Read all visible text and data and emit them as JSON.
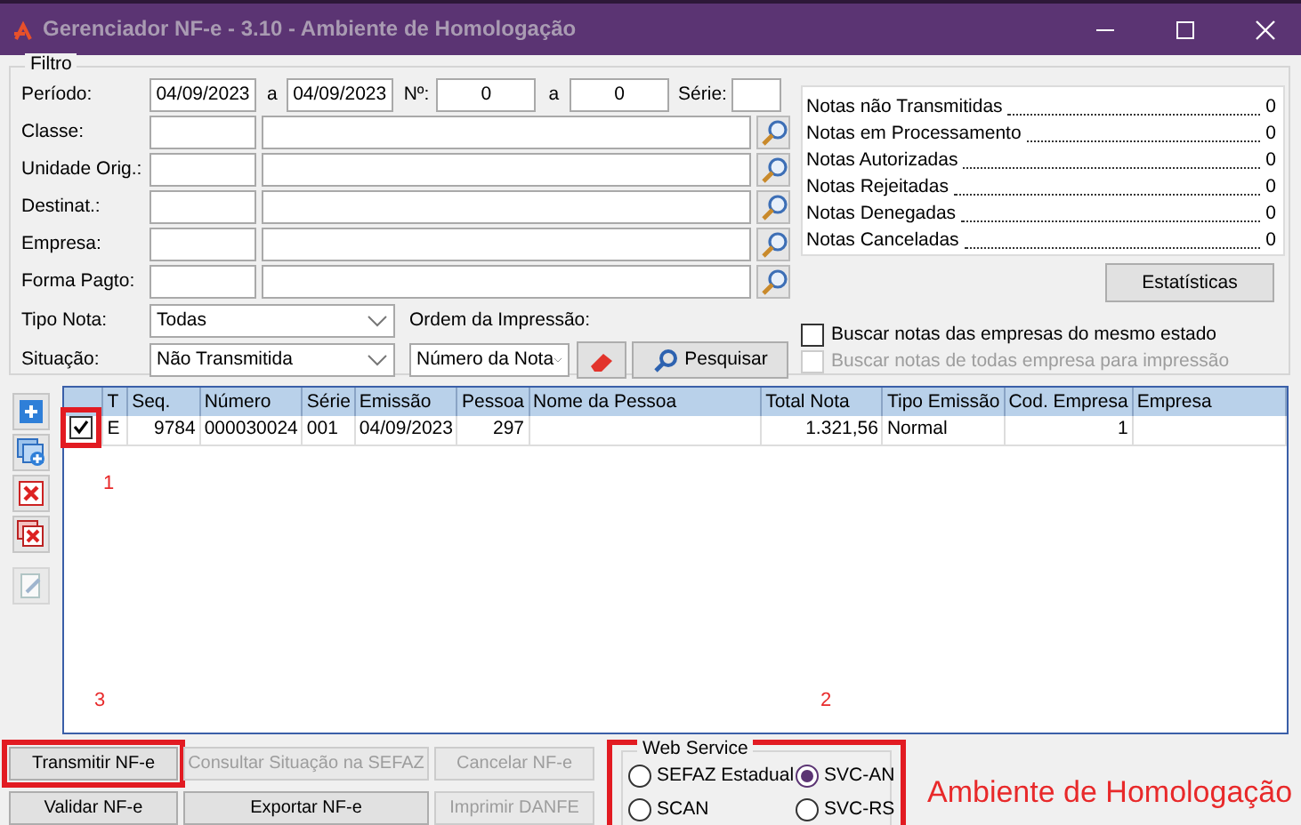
{
  "window": {
    "title": "Gerenciador NF-e - 3.10 - Ambiente de Homologação"
  },
  "filter": {
    "legend": "Filtro",
    "periodo": {
      "label": "Período:",
      "from": "04/09/2023",
      "sep": "a",
      "to": "04/09/2023"
    },
    "numero": {
      "label": "Nº:",
      "from": "0",
      "sep": "a",
      "to": "0"
    },
    "serie": {
      "label": "Série:"
    },
    "lookups": [
      {
        "label": "Classe:"
      },
      {
        "label": "Unidade Orig.:"
      },
      {
        "label": "Destinat.:"
      },
      {
        "label": "Empresa:"
      },
      {
        "label": "Forma Pagto:"
      }
    ],
    "tipo_nota": {
      "label": "Tipo Nota:",
      "value": "Todas"
    },
    "situacao": {
      "label": "Situação:",
      "value": "Não Transmitida"
    },
    "ordem": {
      "label": "Ordem da Impressão:",
      "value": "Número da Nota"
    },
    "search_button": "Pesquisar"
  },
  "stats": {
    "items": [
      {
        "label": "Notas não Transmitidas",
        "value": "0"
      },
      {
        "label": "Notas em Processamento",
        "value": "0"
      },
      {
        "label": "Notas Autorizadas",
        "value": "0"
      },
      {
        "label": "Notas Rejeitadas",
        "value": "0"
      },
      {
        "label": "Notas Denegadas",
        "value": "0"
      },
      {
        "label": "Notas Canceladas",
        "value": "0"
      }
    ],
    "button": "Estatísticas"
  },
  "options": [
    {
      "label": "Buscar notas das empresas do mesmo estado",
      "checked": false,
      "disabled": false
    },
    {
      "label": "Buscar notas de todas empresa para impressão",
      "checked": false,
      "disabled": true
    }
  ],
  "toolbar": [
    {
      "kind": "add",
      "disabled": false
    },
    {
      "kind": "duplicate",
      "disabled": false
    },
    {
      "kind": "delete",
      "disabled": false
    },
    {
      "kind": "delete-all",
      "disabled": false
    },
    {
      "kind": "edit",
      "disabled": true
    }
  ],
  "table": {
    "columns": [
      "T",
      "Seq.",
      "Número",
      "Série",
      "Emissão",
      "Pessoa",
      "Nome da Pessoa",
      "Total Nota",
      "Tipo Emissão",
      "Cod. Empresa",
      "Empresa"
    ],
    "rows": [
      {
        "checked": true,
        "highlighted": true,
        "cells": [
          "E",
          "9784",
          "000030024",
          "001",
          "04/09/2023",
          "297",
          null,
          "1.321,56",
          "Normal",
          "1",
          null
        ]
      }
    ]
  },
  "annotations": [
    {
      "text": "1"
    },
    {
      "text": "3"
    },
    {
      "text": "2"
    }
  ],
  "buttons": [
    {
      "label": "Transmitir NF-e",
      "disabled": false,
      "highlighted": true
    },
    {
      "label": "Consultar Situação na SEFAZ",
      "disabled": true,
      "highlighted": false
    },
    {
      "label": "Cancelar NF-e",
      "disabled": true,
      "highlighted": false
    },
    {
      "label": "Validar NF-e",
      "disabled": false,
      "highlighted": false
    },
    {
      "label": "Exportar NF-e",
      "disabled": false,
      "highlighted": false
    },
    {
      "label": "Imprimir DANFE",
      "disabled": true,
      "highlighted": false
    }
  ],
  "web_service": {
    "legend": "Web Service",
    "highlighted": true,
    "options": [
      {
        "label": "SEFAZ Estadual",
        "selected": false
      },
      {
        "label": "SVC-AN",
        "selected": true
      },
      {
        "label": "SCAN",
        "selected": false
      },
      {
        "label": "SVC-RS",
        "selected": false
      }
    ]
  },
  "environment_label": "Ambiente de Homologação"
}
